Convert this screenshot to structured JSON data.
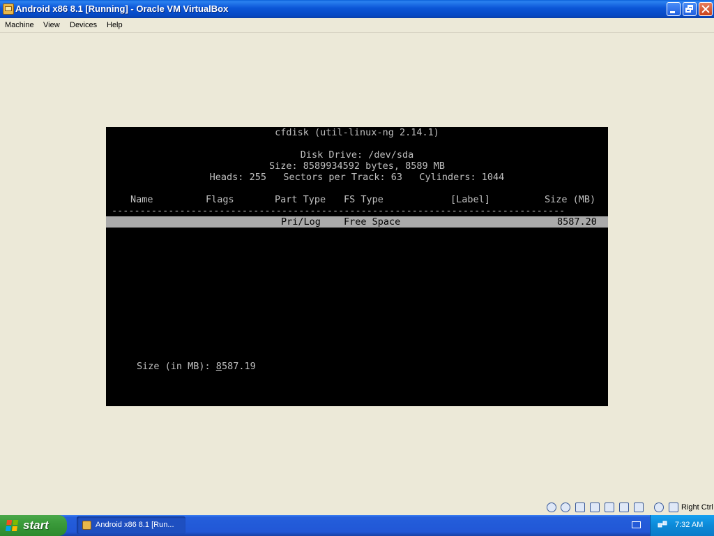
{
  "window": {
    "title": "Android x86 8.1 [Running] - Oracle VM VirtualBox"
  },
  "menu": [
    "Machine",
    "View",
    "Devices",
    "Help"
  ],
  "console": {
    "header": "cfdisk (util-linux-ng 2.14.1)",
    "disk_drive": "Disk Drive: /dev/sda",
    "size_line": "Size: 8589934592 bytes, 8589 MB",
    "geometry_line": "Heads: 255   Sectors per Track: 63   Cylinders: 1044",
    "columns": {
      "name": "Name",
      "flags": "Flags",
      "part_type": "Part Type",
      "fs_type": "FS Type",
      "label": "[Label]",
      "size": "Size (MB)"
    },
    "separator": "--------------------------------------------------------------------------------",
    "selected_row": {
      "part_type": "Pri/Log",
      "fs_type": "Free Space",
      "size": "8587.20"
    },
    "prompt": {
      "label": "Size (in MB): ",
      "first_digit": "8",
      "rest": "587.19"
    }
  },
  "statusbar": {
    "host_key": "Right Ctrl"
  },
  "taskbar": {
    "start_label": "start",
    "task_label": "Android x86 8.1 [Run...",
    "clock": "7:32 AM"
  },
  "colors": {
    "console_bg": "#000000",
    "console_fg": "#c0c0c0",
    "highlight_bg": "#aaaaaa"
  }
}
